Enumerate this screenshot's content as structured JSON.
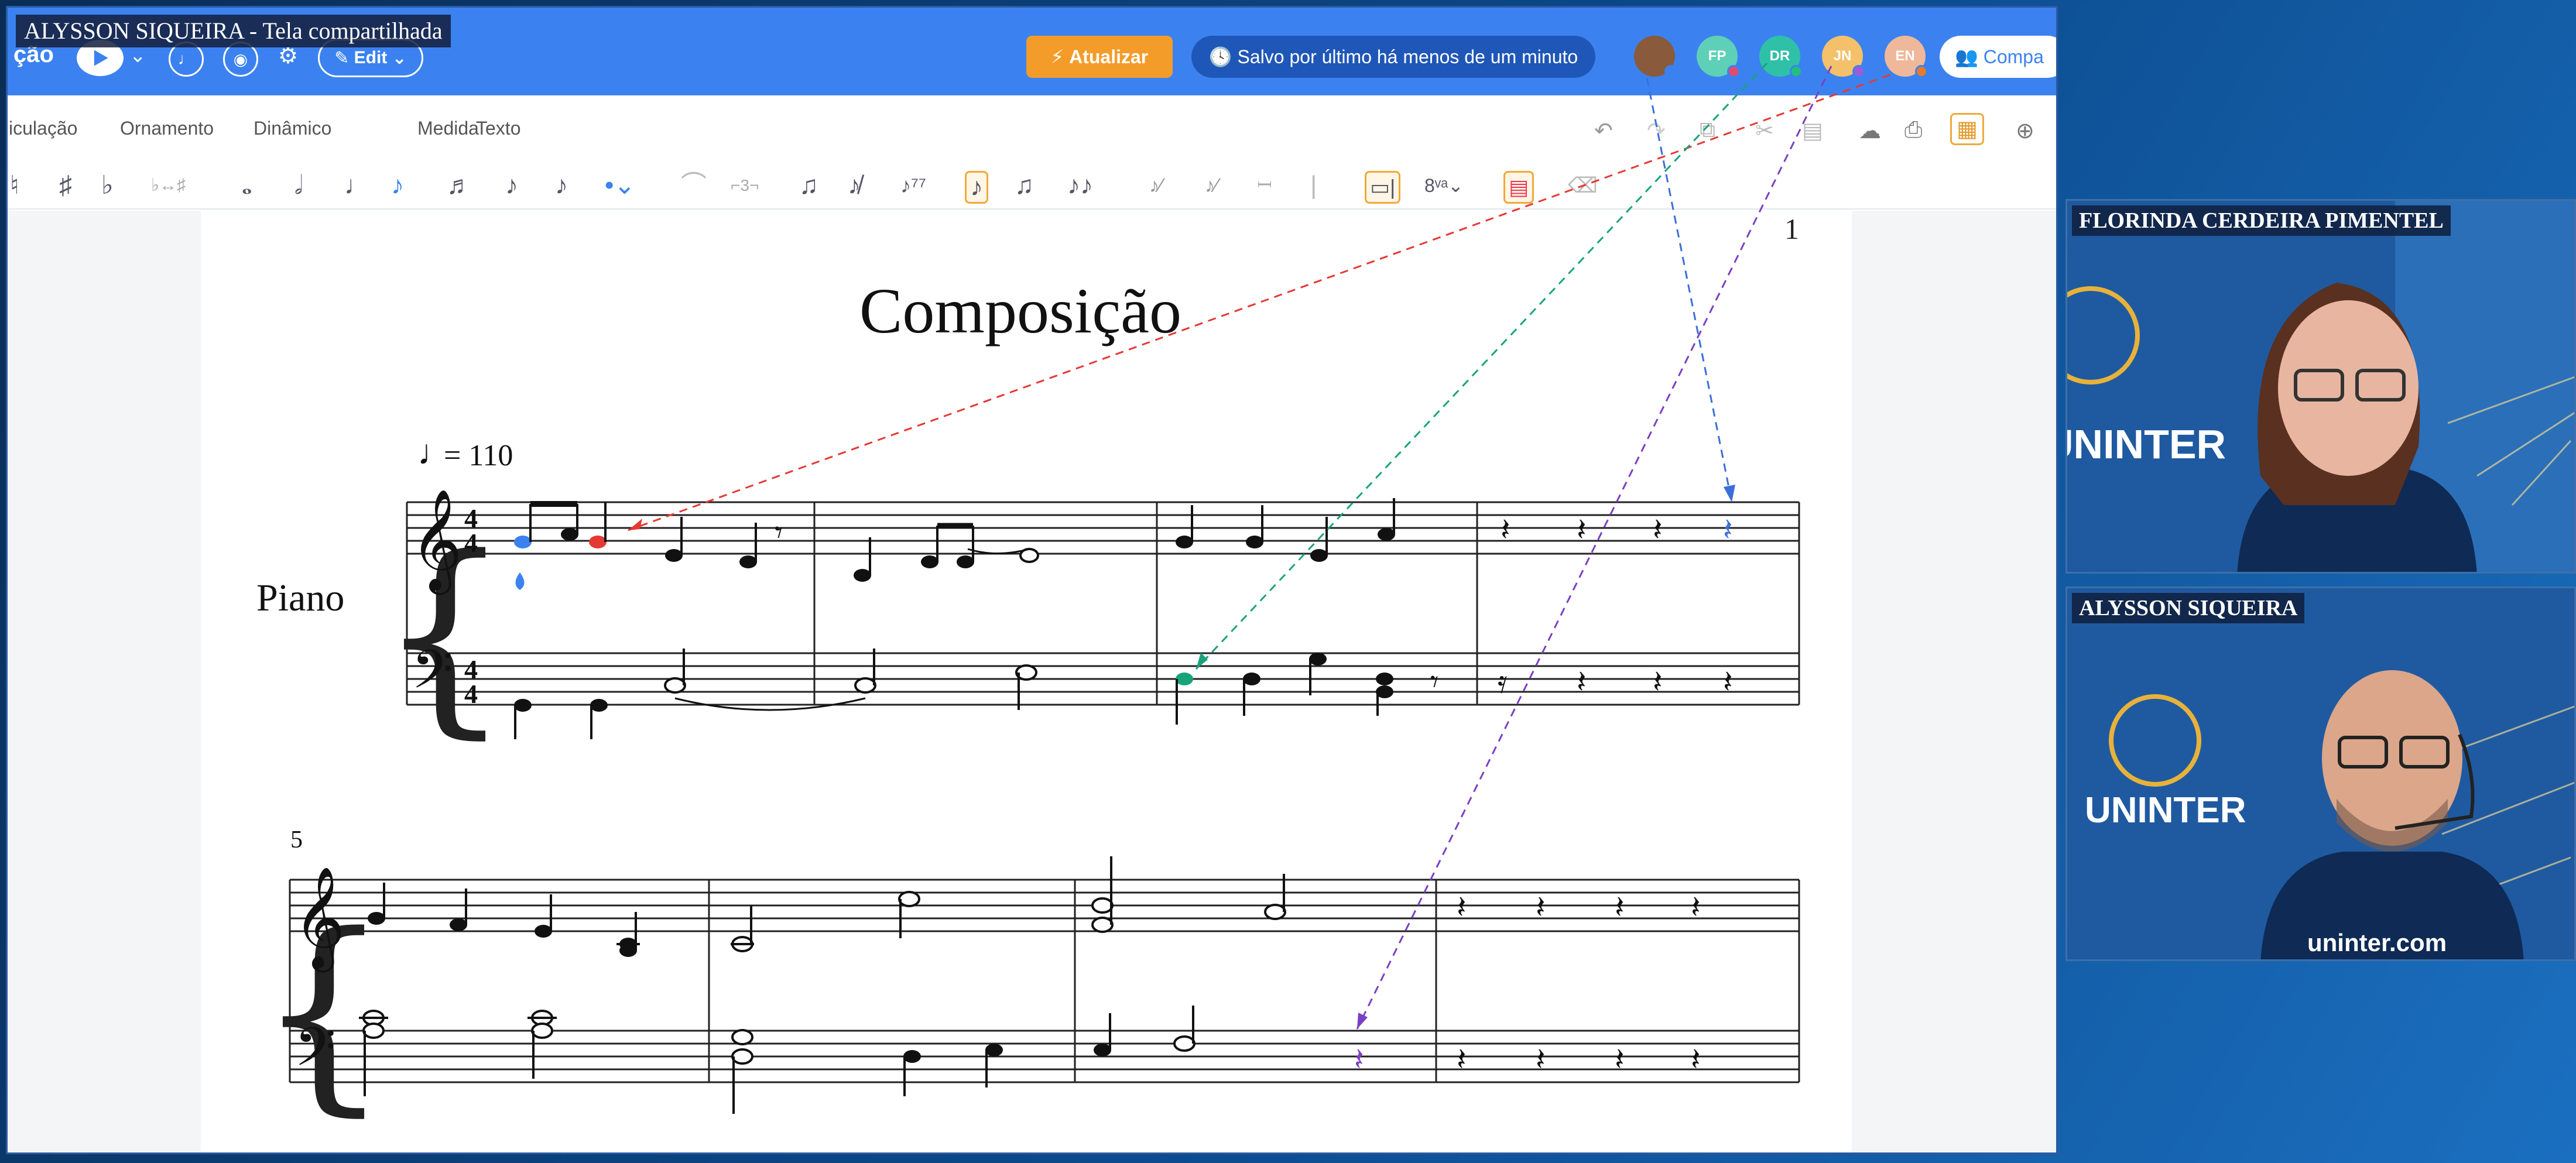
{
  "share": {
    "label": "ALYSSON SIQUEIRA - Tela compartilhada"
  },
  "topbar": {
    "app_title": "ção",
    "edit_label": "Edit",
    "update_button": "Atualizar",
    "save_status": "Salvo por último há menos de um minuto",
    "share_button": "Compa",
    "avatars": [
      {
        "initials": "",
        "color": "#8a5a3c",
        "dot": "#3b82f0"
      },
      {
        "initials": "FP",
        "color": "#5fd0b8",
        "dot": "#e24b6b"
      },
      {
        "initials": "DR",
        "color": "#2fc0a8",
        "dot": "#22c07a"
      },
      {
        "initials": "JN",
        "color": "#f4c16a",
        "dot": "#9b5cd9"
      },
      {
        "initials": "EN",
        "color": "#f0b89a",
        "dot": "#e67a2e"
      }
    ]
  },
  "menu": {
    "items": [
      "iculação",
      "Ornamento",
      "Dinâmico",
      "Medida",
      "Texto"
    ]
  },
  "score": {
    "page_number": "1",
    "title": "Composição",
    "tempo": "= 110",
    "instrument": "Piano",
    "measure_number": "5"
  },
  "participants": [
    {
      "name": "FLORINDA CERDEIRA PIMENTEL"
    },
    {
      "name": "ALYSSON SIQUEIRA"
    }
  ],
  "brand": {
    "logo": "UNINTER",
    "shirt": "uninter.com"
  },
  "colors": {
    "topbar": "#3b82f0",
    "update": "#f39c2a",
    "red": "#e53935",
    "green": "#1aa37a",
    "blue": "#3b6fd8",
    "purple": "#7b3fc4"
  }
}
